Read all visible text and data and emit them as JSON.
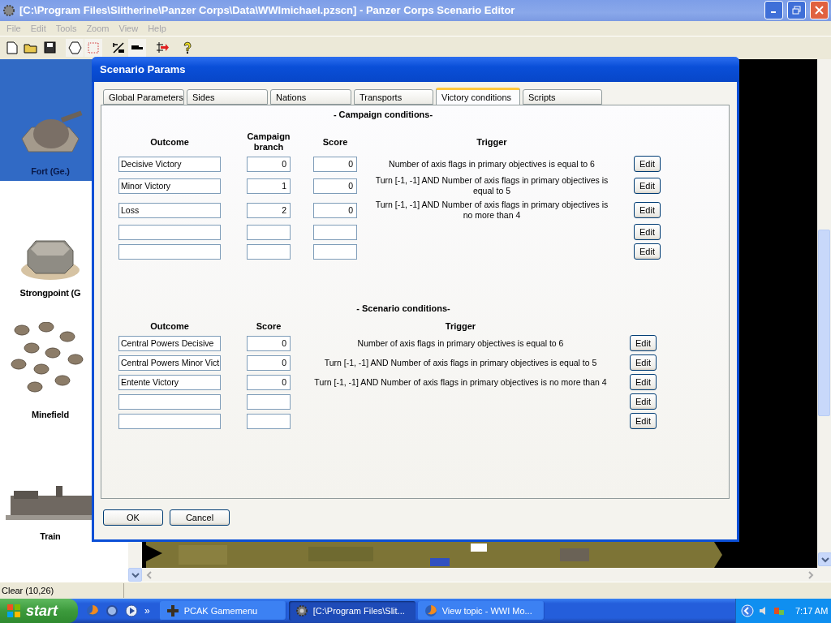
{
  "window": {
    "title": "[C:\\Program Files\\Slitherine\\Panzer Corps\\Data\\WWImichael.pzscn] - Panzer Corps Scenario Editor"
  },
  "menu": [
    {
      "label": "File",
      "disabled": true
    },
    {
      "label": "Edit",
      "disabled": true
    },
    {
      "label": "Tools",
      "disabled": true
    },
    {
      "label": "Zoom",
      "disabled": true
    },
    {
      "label": "View",
      "disabled": true
    },
    {
      "label": "Help",
      "disabled": true
    }
  ],
  "toolbar": [
    {
      "kind": "new",
      "pressed": false
    },
    {
      "kind": "open",
      "pressed": false
    },
    {
      "kind": "save",
      "pressed": false
    },
    {
      "kind": "hex",
      "pressed": true
    },
    {
      "kind": "rect",
      "pressed": true
    },
    {
      "kind": "unit",
      "pressed": false
    },
    {
      "kind": "truck",
      "pressed": true
    },
    {
      "kind": "arrows",
      "pressed": false
    },
    {
      "kind": "help",
      "pressed": false
    }
  ],
  "palette": {
    "items": [
      {
        "label": "Fort (Ge.)",
        "kind": "fort",
        "selected": true
      },
      {
        "label": "Strongpoint (G",
        "kind": "strongpoint",
        "selected": false
      },
      {
        "label": "Minefield",
        "kind": "mines",
        "selected": false
      },
      {
        "label": "Train",
        "kind": "train",
        "selected": false
      }
    ]
  },
  "dialog": {
    "title": "Scenario Params",
    "tabs": [
      {
        "label": "Global Parameters",
        "selected": false
      },
      {
        "label": "Sides",
        "selected": false
      },
      {
        "label": "Nations",
        "selected": false
      },
      {
        "label": "Transports",
        "selected": false
      },
      {
        "label": "Victory conditions",
        "selected": true
      },
      {
        "label": "Scripts",
        "selected": false
      }
    ],
    "campaign": {
      "heading": "- Campaign conditions-",
      "columns": [
        "Outcome",
        "Campaign branch",
        "Score",
        "Trigger"
      ],
      "rows": [
        {
          "outcome": "Decisive Victory",
          "branch": "0",
          "score": "0",
          "trigger": "Number of axis flags in primary objectives is equal to 6",
          "edit": "Edit"
        },
        {
          "outcome": "Minor Victory",
          "branch": "1",
          "score": "0",
          "trigger": "Turn [-1, -1] AND Number of axis flags in primary objectives is equal to 5",
          "edit": "Edit"
        },
        {
          "outcome": "Loss",
          "branch": "2",
          "score": "0",
          "trigger": "Turn [-1, -1] AND Number of axis flags in primary objectives is no more than 4",
          "edit": "Edit"
        },
        {
          "edit": "Edit"
        },
        {
          "edit": "Edit"
        }
      ]
    },
    "scenario": {
      "heading": "- Scenario conditions-",
      "columns": [
        "Outcome",
        "Score",
        "Trigger"
      ],
      "rows": [
        {
          "outcome": "Central Powers Decisive",
          "score": "0",
          "trigger": "Number of axis flags in primary objectives is equal to 6",
          "edit": "Edit"
        },
        {
          "outcome": "Central Powers Minor Vict",
          "score": "0",
          "trigger": "Turn [-1, -1] AND Number of axis flags in primary objectives is equal to 5",
          "edit": "Edit"
        },
        {
          "outcome": "Entente Victory",
          "score": "0",
          "trigger": "Turn [-1, -1] AND Number of axis flags in primary objectives is no more than 4",
          "edit": "Edit"
        },
        {
          "edit": "Edit"
        },
        {
          "edit": "Edit"
        }
      ]
    },
    "buttons": [
      "OK",
      "Cancel"
    ]
  },
  "status_bar": "Clear (10,26)",
  "taskbar": {
    "start": "start",
    "more": "»",
    "tasks": [
      {
        "label": "PCAK Gamemenu",
        "kind": "cross",
        "selected": false
      },
      {
        "label": "[C:\\Program Files\\Slit...",
        "kind": "gear",
        "selected": true
      },
      {
        "label": "View topic - WWI Mo...",
        "kind": "globe",
        "selected": false
      }
    ],
    "clock": "7:17 AM"
  }
}
